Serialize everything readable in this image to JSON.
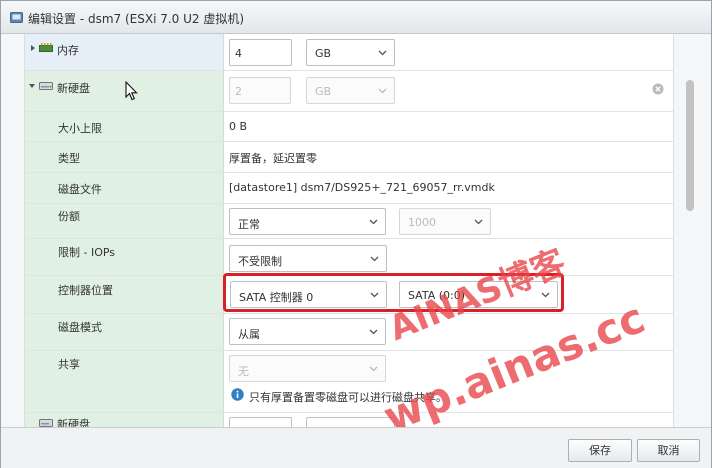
{
  "window": {
    "title": "编辑设置 - dsm7 (ESXi 7.0 U2 虚拟机)"
  },
  "memory": {
    "label": "内存",
    "value": "4",
    "unit": "GB"
  },
  "new_disk": {
    "label": "新硬盘",
    "size_value": "2",
    "size_unit": "GB",
    "max_size_label": "大小上限",
    "max_size_value": "0 B",
    "type_label": "类型",
    "type_value": "厚置备，延迟置零",
    "file_label": "磁盘文件",
    "file_value": "[datastore1] dsm7/DS925+_721_69057_rr.vmdk",
    "shares_label": "份额",
    "shares_value": "正常",
    "shares_number": "1000",
    "limit_label": "限制 - IOPs",
    "limit_value": "不受限制",
    "controller_label": "控制器位置",
    "controller_value": "SATA 控制器 0",
    "controller_slot": "SATA (0:0)",
    "mode_label": "磁盘模式",
    "mode_value": "从属",
    "sharing_label": "共享",
    "sharing_value": "无",
    "sharing_note": "只有厚置备置零磁盘可以进行磁盘共享。"
  },
  "next_disk": {
    "label": "新硬盘"
  },
  "footer": {
    "save_label": "保存",
    "cancel_label": "取消"
  },
  "watermark": {
    "line1": "AINAS博客",
    "line2": "wp.ainas.cc"
  },
  "icons": {
    "app": "vm-settings-icon",
    "memory": "memory-chip-icon",
    "disk": "hard-disk-icon",
    "remove": "remove-circle-icon",
    "info": "info-icon"
  },
  "colors": {
    "label_bg": "#e0f0e3",
    "selected_bg": "#e6eef7",
    "highlight": "#d8202a",
    "watermark": "#e84246",
    "info": "#2f7fc1"
  }
}
